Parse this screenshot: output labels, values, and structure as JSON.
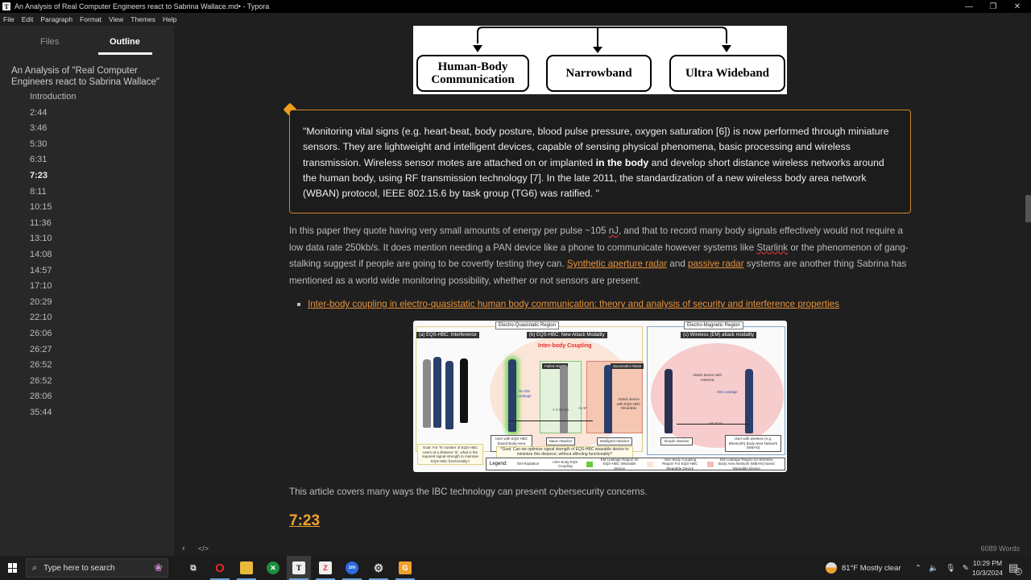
{
  "window": {
    "title": "An Analysis of Real Computer Engineers react to Sabrina Wallace.md• - Typora",
    "app_icon": "T",
    "controls": {
      "minimize": "—",
      "restore": "❐",
      "close": "✕"
    }
  },
  "menubar": [
    "File",
    "Edit",
    "Paragraph",
    "Format",
    "View",
    "Themes",
    "Help"
  ],
  "sidebar": {
    "tabs": [
      {
        "label": "Files",
        "active": false
      },
      {
        "label": "Outline",
        "active": true
      }
    ],
    "outline_title": "An Analysis of \"Real Computer Engineers react to Sabrina Wallace\"",
    "items": [
      {
        "label": "Introduction"
      },
      {
        "label": "2:44"
      },
      {
        "label": "3:46"
      },
      {
        "label": "5:30"
      },
      {
        "label": "6:31"
      },
      {
        "label": "7:23",
        "active": true
      },
      {
        "label": "8:11"
      },
      {
        "label": "10:15"
      },
      {
        "label": "11:36"
      },
      {
        "label": "13:10"
      },
      {
        "label": "14:08"
      },
      {
        "label": "14:57"
      },
      {
        "label": "17:10"
      },
      {
        "label": "20:29"
      },
      {
        "label": "22:10"
      },
      {
        "label": "26:06"
      },
      {
        "label": "26:27"
      },
      {
        "label": "26:52"
      },
      {
        "label": "26:52"
      },
      {
        "label": "28:06"
      },
      {
        "label": "35:44"
      }
    ]
  },
  "document": {
    "diagram": {
      "boxes": [
        "Human-Body Communication",
        "Narrowband",
        "Ultra Wideband"
      ]
    },
    "quote": {
      "before_bold": "\"Monitoring vital signs (e.g. heart-beat, body posture, blood pulse pressure, oxygen saturation [6]) is now performed through miniature sensors. They are lightweight and intelligent devices, capable of sensing physical phenomena, basic processing and wireless transmission. Wireless sensor motes are attached on or implanted ",
      "bold": "in the body",
      "after_bold": " and develop short distance wireless networks around the human body, using RF transmission technology [7]. In the late 2011, the standardization of a new wireless body area network (WBAN) protocol, IEEE 802.15.6 by task group (TG6) was ratified. \""
    },
    "paragraph": {
      "p1": "In this paper they quote having very small amounts of energy per pulse ~105 ",
      "nj": "nJ",
      "p2": ", and that to record many body signals effectively would not require a low data rate 250kb/s. It does mention needing a PAN device like a phone to communicate however systems like ",
      "starlink": "Starlink",
      "p3": " or the phenomenon of gang-stalking suggest if people are going to be covertly testing they can. ",
      "link1": "Synthetic aperture radar",
      "p4": " and ",
      "link2": "passive radar",
      "p5": " systems are another thing Sabrina has mentioned as a world wide monitoring possibility, whether or not sensors are present."
    },
    "bullet_link": "Inter-body coupling in electro-quasistatic human body communication: theory and analysis of security and interference properties",
    "figure": {
      "region_eqs": "Electro-Quasistatic Region",
      "region_em": "Electro-Magnetic Region",
      "panel_a": "(a) EQS-HBC: Interference",
      "panel_b": "(b) EQS-HBC: New Attack Modality",
      "panel_c": "(c) Wireless (EM) attack modality",
      "coupling": "Inter-body Coupling",
      "failed": "Failed Attack",
      "successful": "Successful Attack",
      "user_eqs": "User with EQS-HBC based Body-area Network",
      "naive": "Naive Attacker",
      "intelligent": "Intelligent Attacker",
      "simple": "Simple Attacker",
      "user_wireless": "User with wireless (e.g. Bluetooth) Body-area Network (WBAN)",
      "goal_a": "Goal: For 'N' number of EQS-HBC users at a distance 'dᵢ', what is the required signal strength to maintain EQS-HBC functionality?",
      "goal_b": "*Goal: Can we optimize signal strength of EQS-HBC wearable device to minimize this distance, without affecting functionality?",
      "attack_antenna": "Attack device with Antenna",
      "attack_wearable": "Attack device with EQS-HBC Wearable",
      "em_leakage": "EM Leakage",
      "no_em": "No EM Leakage",
      "distance_em": "~ 5-10 m",
      "distance_b1": "< 1-10 cm",
      "distance_b2": "~1 m*",
      "legend_title": "Legend:",
      "legend": [
        "EM Radiation",
        "Inter-body EQS Coupling",
        "EM Leakage Region for EQS-HBC Wearable Device",
        "Inter-Body Coupling Region For EQS-HBC Wearable Device",
        "EM Leakage Region for Wireless Body Area Network (WBAN) based Wearable Device"
      ]
    },
    "paragraph2": "This article covers many ways the IBC technology can present cybersecurity concerns.",
    "heading": "7:23"
  },
  "statusbar": {
    "word_count": "6089 Words",
    "back_icon": "‹",
    "source_icon": "</>"
  },
  "taskbar": {
    "search_placeholder": "Type here to search",
    "weather": "81°F  Mostly clear",
    "time": "10:29 PM",
    "date": "10/3/2024",
    "notification_count": "1",
    "colors": {
      "accent": "#f0a22e",
      "link": "#e8923a",
      "taskbar_underline": "#6ba0d8"
    }
  }
}
